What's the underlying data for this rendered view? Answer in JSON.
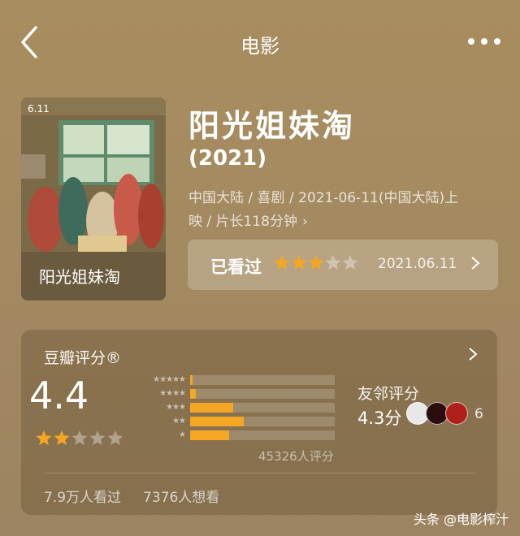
{
  "header": {
    "title": "电影",
    "back_icon": "chevron-left-icon",
    "more_icon": "more-dots-icon"
  },
  "movie": {
    "title": "阳光姐妹淘",
    "year": "(2021)",
    "meta_line1": "中国大陆 / 喜剧 / 2021-06-11(中国大陆)上",
    "meta_line2": "映 / 片长118分钟",
    "meta_arrow": "›",
    "poster": {
      "date_label": "6.11",
      "title_art": "阳光姐妹淘"
    }
  },
  "watched": {
    "label": "已看过",
    "rating_stars": 3,
    "max_stars": 5,
    "date": "2021.06.11",
    "arrow": "›"
  },
  "douban": {
    "header": "豆瓣评分®",
    "score": "4.4",
    "score_stars": 2,
    "max_stars": 5,
    "distribution": [
      {
        "stars": "★★★★★",
        "percent": 1
      },
      {
        "stars": "★★★★",
        "percent": 4
      },
      {
        "stars": "★★★",
        "percent": 30
      },
      {
        "stars": "★★",
        "percent": 37
      },
      {
        "stars": "★",
        "percent": 27
      }
    ],
    "votes": "45326人评分",
    "friends_label": "友邻评分",
    "friends_score": "4.3分",
    "friends_count": "6",
    "seen": "7.9万人看过",
    "want": "7376人想看"
  },
  "colors": {
    "star": "#f5a623",
    "star_empty": "rgba(255,255,255,0.35)",
    "bar": "#f5a623"
  },
  "watermark": "头条 @电影榨汁"
}
